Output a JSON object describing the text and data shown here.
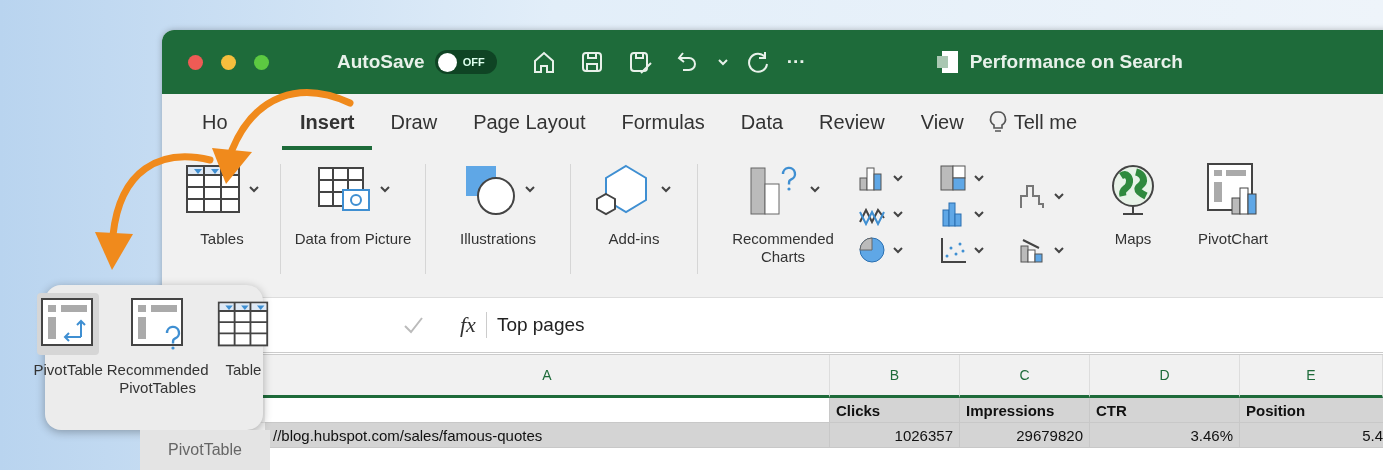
{
  "window": {
    "title": "Performance on Search"
  },
  "toolbar": {
    "autosave_label": "AutoSave",
    "autosave": {
      "label": "OFF",
      "on": false
    },
    "more": "···"
  },
  "tabs": [
    {
      "label": "Ho",
      "selected": false
    },
    {
      "label": "Insert",
      "selected": true
    },
    {
      "label": "Draw",
      "selected": false
    },
    {
      "label": "Page Layout",
      "selected": false
    },
    {
      "label": "Formulas",
      "selected": false
    },
    {
      "label": "Data",
      "selected": false
    },
    {
      "label": "Review",
      "selected": false
    },
    {
      "label": "View",
      "selected": false
    }
  ],
  "tell_me": "Tell me",
  "ribbon": [
    {
      "kind": "tables",
      "label": "Tables"
    },
    {
      "kind": "picture",
      "label": "Data from Picture"
    },
    {
      "kind": "illustrations",
      "label": "Illustrations"
    },
    {
      "kind": "addins",
      "label": "Add-ins"
    },
    {
      "kind": "recommended",
      "label": "Recommended Charts"
    },
    {
      "kind": "chartgrid"
    },
    {
      "kind": "maps",
      "label": "Maps"
    },
    {
      "kind": "pivotchart",
      "label": "PivotChart"
    }
  ],
  "formula_bar": {
    "fx": "fx",
    "value": "Top pages"
  },
  "columns": [
    "A",
    "B",
    "C",
    "D",
    "E"
  ],
  "rows": [
    {
      "kind": "header",
      "cells": {
        "B": "Clicks",
        "C": "Impressions",
        "D": "CTR",
        "E": "Position"
      }
    },
    {
      "kind": "data",
      "cells": {
        "A": "//blog.hubspot.com/sales/famous-quotes",
        "B": "1026357",
        "C": "29679820",
        "D": "3.46%",
        "E": "5.4"
      }
    }
  ],
  "popup": {
    "items": [
      {
        "kind": "pivot",
        "label": "PivotTable",
        "selected": true
      },
      {
        "kind": "recommended",
        "label": "Recommended PivotTables",
        "selected": false
      },
      {
        "kind": "table",
        "label": "Table",
        "selected": false
      }
    ]
  },
  "tooltip": "PivotTable"
}
